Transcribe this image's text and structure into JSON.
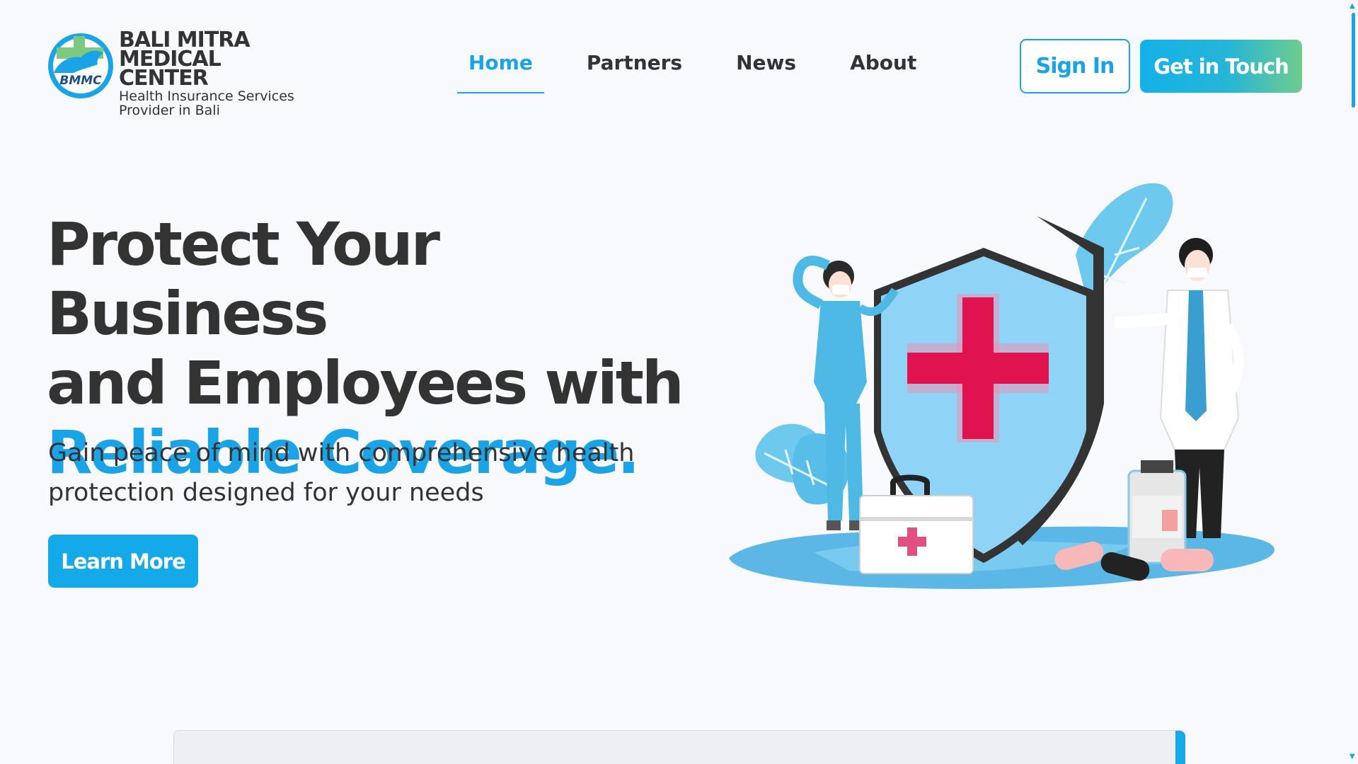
{
  "brand": {
    "line1": "BALI MITRA",
    "line2": "MEDICAL CENTER",
    "tagline_line1": "Health Insurance Services",
    "tagline_line2": "Provider in Bali",
    "emblem_text": "BMMC"
  },
  "nav": {
    "items": [
      {
        "label": "Home",
        "active": true
      },
      {
        "label": "Partners",
        "active": false
      },
      {
        "label": "News",
        "active": false
      },
      {
        "label": "About",
        "active": false
      }
    ]
  },
  "header_actions": {
    "sign_in": "Sign In",
    "get_in_touch": "Get in Touch"
  },
  "hero": {
    "title_line1": "Protect Your Business",
    "title_line2": "and Employees with",
    "title_accent": "Reliable Coverage.",
    "subtitle": "Gain peace of mind with comprehensive health protection designed for your needs",
    "cta": "Learn More"
  },
  "colors": {
    "accent": "#1aa3e6",
    "text": "#333333",
    "background": "#f8f9fc",
    "cross": "#e0134f",
    "gradient_end": "#6fcc8c"
  },
  "icons": {
    "illustration": "doctors-with-shield-illustration"
  }
}
